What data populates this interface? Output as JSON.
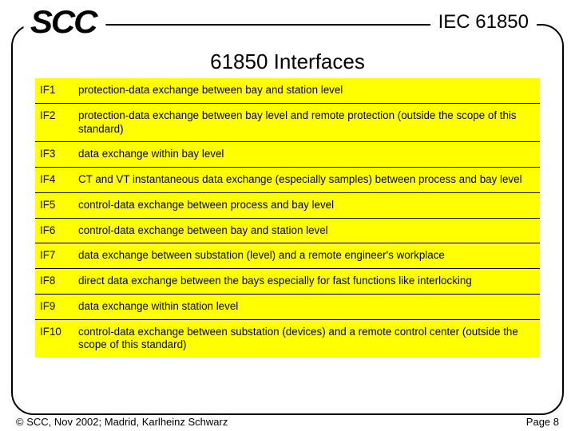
{
  "header": {
    "logo": "SCC",
    "right": "IEC 61850"
  },
  "title": "61850 Interfaces",
  "interfaces": [
    {
      "id": "IF1",
      "desc": "protection-data exchange between bay and station level"
    },
    {
      "id": "IF2",
      "desc": "protection-data exchange between bay level and remote protection (outside the scope of this standard)"
    },
    {
      "id": "IF3",
      "desc": "data exchange within bay level"
    },
    {
      "id": "IF4",
      "desc": "CT and VT instantaneous data exchange (especially samples) between process and bay level"
    },
    {
      "id": "IF5",
      "desc": "control-data exchange between process and bay level"
    },
    {
      "id": "IF6",
      "desc": "control-data exchange between bay and station level"
    },
    {
      "id": "IF7",
      "desc": "data exchange between substation (level) and a remote engineer's workplace"
    },
    {
      "id": "IF8",
      "desc": "direct data exchange between the bays especially for fast functions like interlocking"
    },
    {
      "id": "IF9",
      "desc": "data exchange within station level"
    },
    {
      "id": "IF10",
      "desc": "control-data exchange between substation (devices) and a remote control center (outside the scope of this standard)"
    }
  ],
  "footer": {
    "left": "© SCC, Nov 2002; Madrid, Karlheinz Schwarz",
    "right": "Page 8"
  }
}
